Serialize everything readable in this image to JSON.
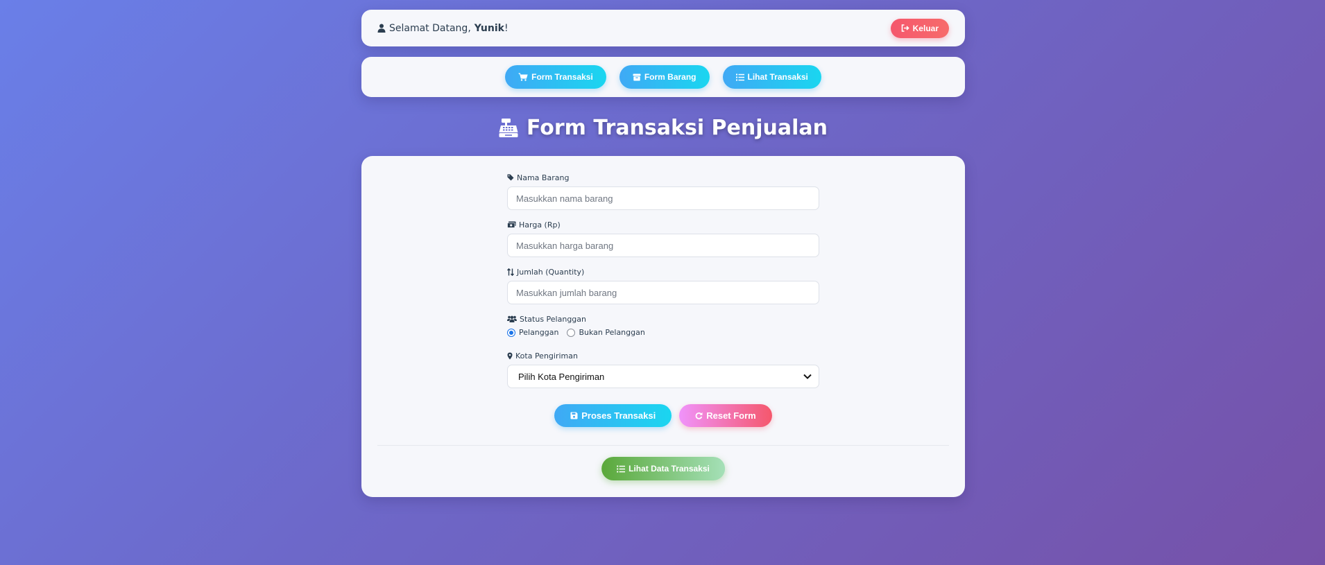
{
  "header": {
    "welcome_prefix": "Selamat Datang,",
    "username": "Yunik",
    "welcome_suffix": "!",
    "user_icon": "user-icon",
    "logout_label": "Keluar",
    "logout_icon": "sign-out-icon"
  },
  "nav": {
    "items": [
      {
        "label": "Form Transaksi",
        "icon": "shopping-cart-icon"
      },
      {
        "label": "Form Barang",
        "icon": "box-icon"
      },
      {
        "label": "Lihat Transaksi",
        "icon": "list-icon"
      }
    ]
  },
  "page": {
    "title": "Form Transaksi Penjualan",
    "title_icon": "cash-register-icon"
  },
  "form": {
    "nama_barang": {
      "label": "Nama Barang",
      "placeholder": "Masukkan nama barang",
      "icon": "tag-icon"
    },
    "harga": {
      "label": "Harga (Rp)",
      "placeholder": "Masukkan harga barang",
      "icon": "money-bill-icon"
    },
    "jumlah": {
      "label": "Jumlah (Quantity)",
      "placeholder": "Masukkan jumlah barang",
      "icon": "sort-arrows-icon"
    },
    "status": {
      "label": "Status Pelanggan",
      "icon": "users-icon",
      "options": [
        "Pelanggan",
        "Bukan Pelanggan"
      ],
      "selected": "Pelanggan"
    },
    "kota": {
      "label": "Kota Pengiriman",
      "selected": "Pilih Kota Pengiriman",
      "icon": "map-marker-icon"
    },
    "process_label": "Proses Transaksi",
    "process_icon": "save-icon",
    "reset_label": "Reset Form",
    "reset_icon": "redo-icon",
    "view_label": "Lihat Data Transaksi",
    "view_icon": "list-icon"
  },
  "colors": {
    "primary_gradient": [
      "#3fa9f5",
      "#1ad6f0"
    ],
    "danger": "#f5576c",
    "success": "#5aa83a",
    "background_gradient": [
      "#6a7fe8",
      "#7651a8"
    ]
  }
}
